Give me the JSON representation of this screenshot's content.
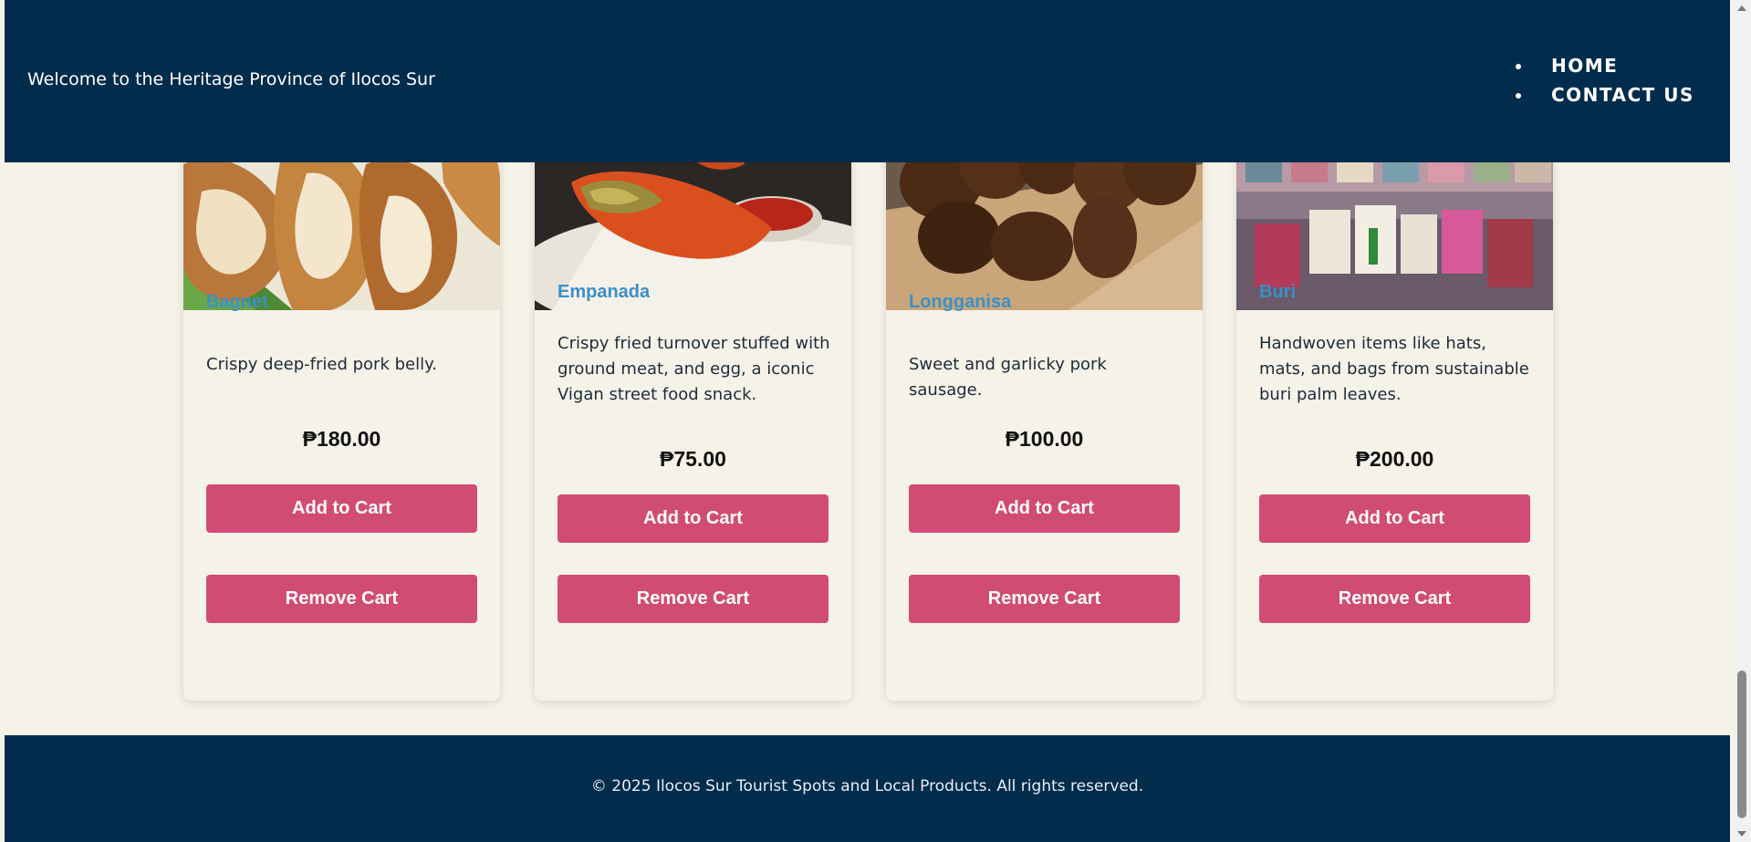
{
  "header": {
    "welcome": "Welcome to the Heritage Province of Ilocos Sur",
    "nav": [
      "HOME",
      "CONTACT US"
    ]
  },
  "products": [
    {
      "name": "Bagnet",
      "description": "Crispy deep-fried pork belly.",
      "price": "₱180.00",
      "add_label": "Add to Cart",
      "remove_label": "Remove Cart",
      "image": "fried-pork-belly-photo"
    },
    {
      "name": "Empanada",
      "description": "Crispy fried turnover stuffed with ground meat, and egg, a iconic Vigan street food snack.",
      "price": "₱75.00",
      "add_label": "Add to Cart",
      "remove_label": "Remove Cart",
      "image": "empanada-photo"
    },
    {
      "name": "Longganisa",
      "description": "Sweet and garlicky pork sausage.",
      "price": "₱100.00",
      "add_label": "Add to Cart",
      "remove_label": "Remove Cart",
      "image": "sausage-photo"
    },
    {
      "name": "Buri",
      "description": "Handwoven items like hats, mats, and bags from sustainable buri palm leaves.",
      "price": "₱200.00",
      "add_label": "Add to Cart",
      "remove_label": "Remove Cart",
      "image": "woven-bags-photo"
    }
  ],
  "footer": {
    "copyright": "© 2025 Ilocos Sur Tourist Spots and Local Products. All rights reserved."
  },
  "colors": {
    "header_bg": "#012c4b",
    "page_bg": "#f5f2e8",
    "accent_button": "#d14c74",
    "product_name": "#3d8fc6"
  }
}
